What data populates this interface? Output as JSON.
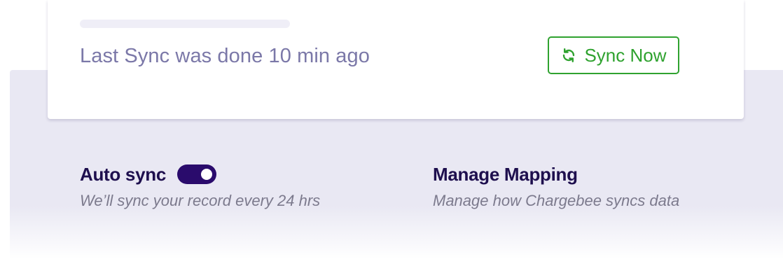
{
  "sync_card": {
    "status_text": "Last Sync was done 10 min ago",
    "sync_button_label": "Sync Now",
    "sync_button_icon": "refresh-icon"
  },
  "auto_sync": {
    "title": "Auto sync",
    "enabled": true,
    "description": "We’ll sync your record every 24 hrs"
  },
  "manage_mapping": {
    "title": "Manage Mapping",
    "description": "Manage how Chargebee syncs data"
  },
  "colors": {
    "accent_green": "#2fa22f",
    "toggle_on": "#2a0b6c",
    "heading": "#1e0f4e",
    "muted_text": "#7b78a8",
    "panel_bg": "#e9e8f3"
  }
}
